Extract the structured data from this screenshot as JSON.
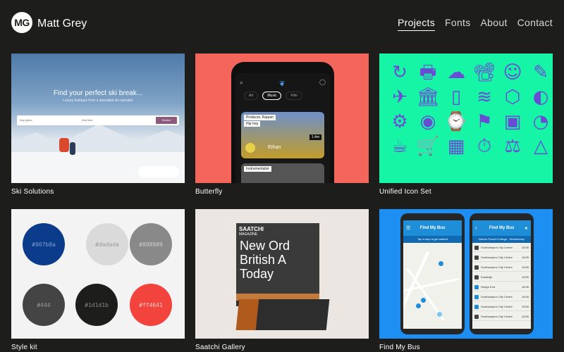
{
  "header": {
    "logo_initials": "MG",
    "site_name": "Matt Grey",
    "nav": [
      {
        "label": "Projects",
        "active": true
      },
      {
        "label": "Fonts",
        "active": false
      },
      {
        "label": "About",
        "active": false
      },
      {
        "label": "Contact",
        "active": false
      }
    ]
  },
  "projects": [
    {
      "title": "Ski Solutions"
    },
    {
      "title": "Butterfly"
    },
    {
      "title": "Unified Icon Set"
    },
    {
      "title": "Style kit"
    },
    {
      "title": "Saatchi Gallery"
    },
    {
      "title": "Find My Bus"
    }
  ],
  "ski": {
    "headline": "Find your perfect ski break...",
    "subline": "Luxury holidays from a specialist ski operator",
    "search_button": "Search",
    "field_where": "Any place",
    "field_when": "Any time"
  },
  "butterfly": {
    "tabs": [
      "Art",
      "Music",
      "Film"
    ],
    "active_tab": "Music",
    "tag1": "Producer, Rapper",
    "tag2": "Hip hop",
    "artist": "Ethan",
    "tag3": "Instrumentalist",
    "count": "1.4m"
  },
  "icons": [
    "↻",
    "🖶",
    "☁",
    "📽",
    "☺",
    "✎",
    "✈",
    "🏛",
    "▯",
    "≋",
    "⬡",
    "◐",
    "⚙",
    "◉",
    "⌚",
    "⚑",
    "▣",
    "◔",
    "☕",
    "🛒",
    "▦",
    "⏱",
    "⚖",
    "△"
  ],
  "stylekit": {
    "swatches": [
      {
        "hex": "#007b8a",
        "bg": "#0b3c8c",
        "fg": "#7f9fcf"
      },
      {
        "hex": "#dadada",
        "bg": "#dadada",
        "fg": "#9a9a9a"
      },
      {
        "hex": "#898989",
        "bg": "#898989",
        "fg": "#cfcfcf"
      },
      {
        "hex": "#444",
        "bg": "#444444",
        "fg": "#9a9a9a"
      },
      {
        "hex": "#1d1d1b",
        "bg": "#1d1d1b",
        "fg": "#8a8a8a"
      },
      {
        "hex": "#ff4641",
        "bg": "#f2433c",
        "fg": "#ffd0ce"
      }
    ]
  },
  "saatchi": {
    "brand": "SAATCHI",
    "brand_sub": "MAGAZINE",
    "title_lines": [
      "New Ord",
      "British A",
      "Today"
    ],
    "fold_text": "New Or British A Today"
  },
  "bus": {
    "app_title": "Find My Bus",
    "map_hint": "Tap a stop to get started",
    "list_header": "Barton Peveril College - Wednesday",
    "departures": [
      {
        "dest": "Southampton City Centre",
        "time": "16:55"
      },
      {
        "dest": "Southampton City Centre",
        "time": "16:55"
      },
      {
        "dest": "Southampton City Centre",
        "time": "16:55"
      },
      {
        "dest": "Eastleigh",
        "time": "16:55"
      },
      {
        "dest": "Hedge End",
        "time": "16:55"
      },
      {
        "dest": "Southampton City Centre",
        "time": "16:55"
      },
      {
        "dest": "Southampton City Centre",
        "time": "16:55"
      },
      {
        "dest": "Southampton City Centre",
        "time": "16:55"
      }
    ]
  }
}
